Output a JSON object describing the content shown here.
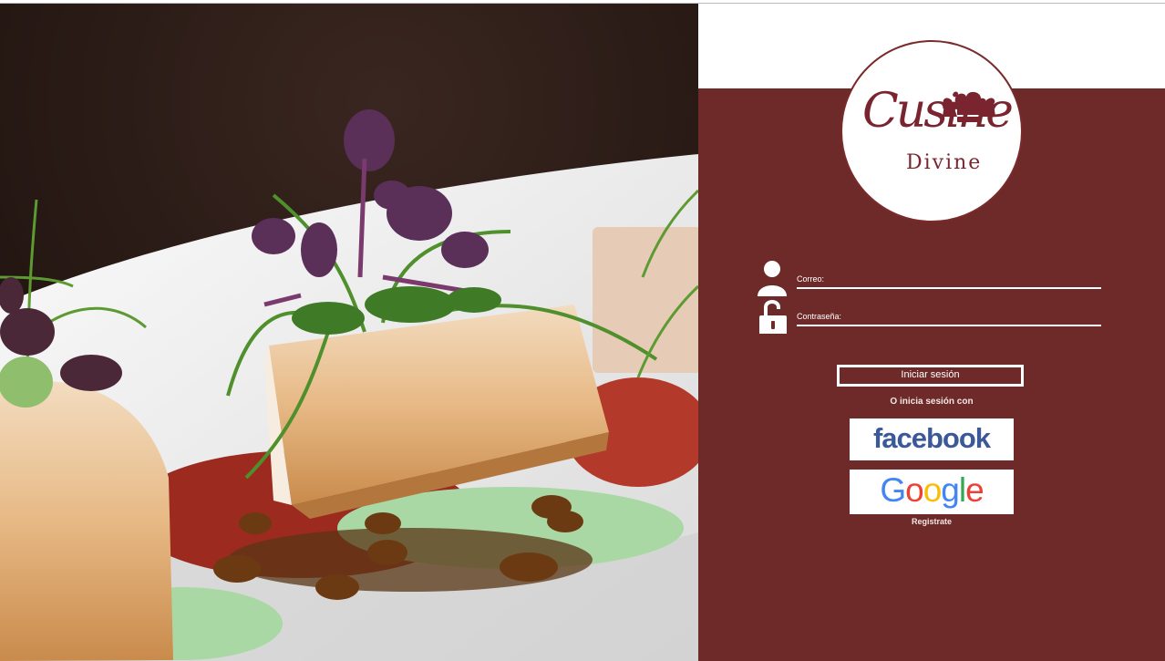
{
  "brand": {
    "logo_script": "Cusine",
    "logo_word": "Divine",
    "primary_color": "#6e2a29",
    "logo_color": "#7a2430"
  },
  "hero": {
    "image_subject": "plated-fish-dish-with-microgreens"
  },
  "login": {
    "email_label": "Correo:",
    "email_value": "",
    "password_label": "Contraseña:",
    "password_value": "",
    "submit_label": "Iniciar sesión",
    "alt_login_text": "O inicia sesión con",
    "register_link": "Registrate"
  },
  "social": {
    "facebook_label": "facebook",
    "facebook_color": "#3b5998",
    "google_letters": [
      "G",
      "o",
      "o",
      "g",
      "l",
      "e"
    ],
    "google_colors": [
      "#4285F4",
      "#EA4335",
      "#FBBC05",
      "#4285F4",
      "#34A853",
      "#EA4335"
    ]
  },
  "icons": {
    "user": "user-icon",
    "password": "unlocked-padlock-icon",
    "logo": "chef-hat-icon"
  }
}
